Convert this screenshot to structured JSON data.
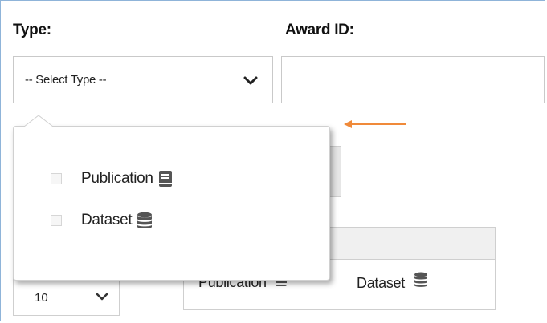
{
  "filters": {
    "type_label": "Type:",
    "award_label": "Award ID:",
    "type_select_value": "-- Select Type --",
    "award_value": ""
  },
  "dropdown": {
    "options": [
      {
        "label": "Publication",
        "icon": "book-icon",
        "checked": false
      },
      {
        "label": "Dataset",
        "icon": "database-icon",
        "checked": false
      }
    ]
  },
  "results": {
    "page_size": "10",
    "row_cells": [
      "Publication",
      "Dataset"
    ]
  },
  "colors": {
    "arrow": "#f08a3a",
    "icon": "#555555"
  }
}
